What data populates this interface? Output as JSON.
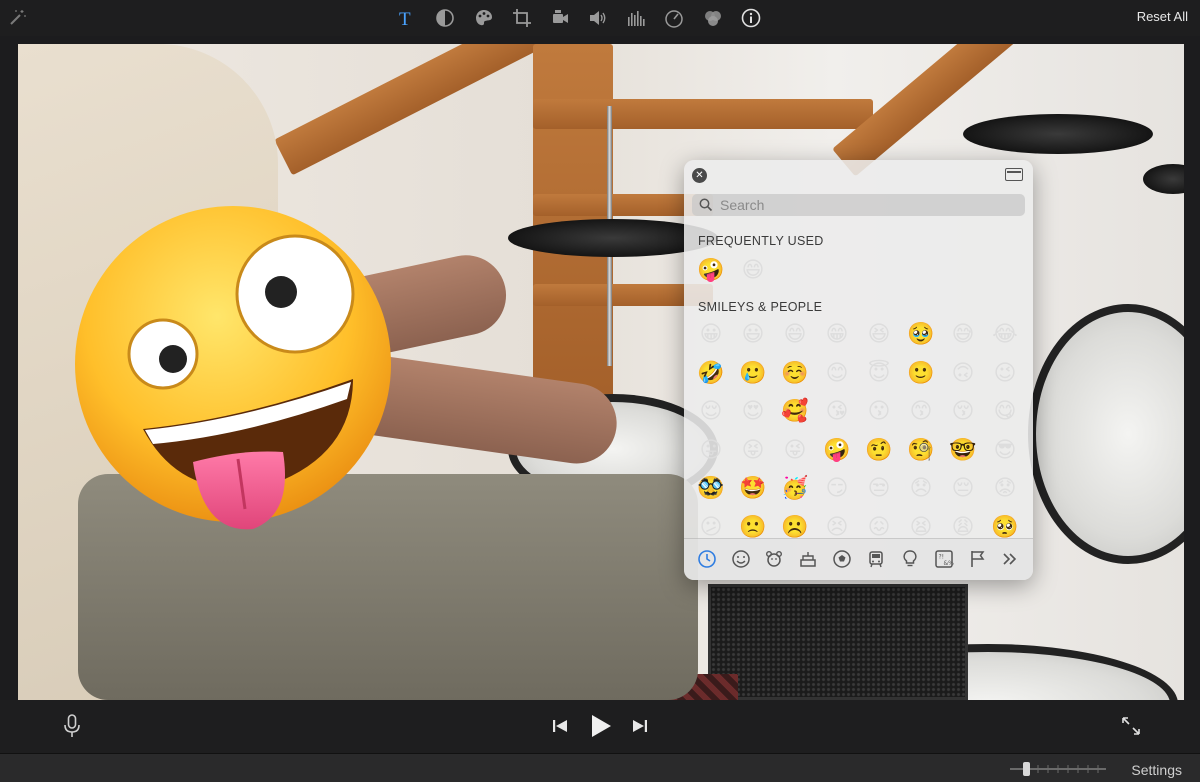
{
  "toolbar": {
    "tools": [
      "magic-wand",
      "title",
      "color-balance",
      "color-correction",
      "crop",
      "stabilization",
      "volume",
      "noise-reduction-equalizer",
      "speed",
      "clip-filter",
      "info"
    ],
    "active_tool": "title",
    "reset_label": "Reset All",
    "accent_color": "#4aa3ff"
  },
  "emoji_picker": {
    "search_placeholder": "Search",
    "frequently_used_title": "FREQUENTLY USED",
    "frequently_used": [
      "🤪",
      "😄"
    ],
    "smileys_title": "SMILEYS & PEOPLE",
    "smileys": [
      "😀",
      "😃",
      "😄",
      "😁",
      "😆",
      "🥹",
      "😅",
      "😂",
      "🤣",
      "🥲",
      "☺️",
      "😊",
      "😇",
      "🙂",
      "🙃",
      "😉",
      "😌",
      "😍",
      "🥰",
      "😘",
      "😗",
      "😙",
      "😚",
      "😋",
      "😛",
      "😝",
      "😜",
      "🤪",
      "🤨",
      "🧐",
      "🤓",
      "😎",
      "🥸",
      "🤩",
      "🥳",
      "😏",
      "😒",
      "😞",
      "😔",
      "😟",
      "😕",
      "🙁",
      "☹️",
      "😣",
      "😖",
      "😫",
      "😩",
      "🥺"
    ],
    "category_tabs": [
      "recent-clock",
      "smileys",
      "animals",
      "food",
      "activity",
      "travel",
      "objects",
      "symbols",
      "flags",
      "more"
    ],
    "active_tab": "recent-clock"
  },
  "sticker_emoji": "zany-face",
  "controls": {
    "buttons": [
      "microphone",
      "skip-back",
      "play",
      "skip-forward",
      "fullscreen"
    ]
  },
  "footer": {
    "settings_label": "Settings"
  }
}
